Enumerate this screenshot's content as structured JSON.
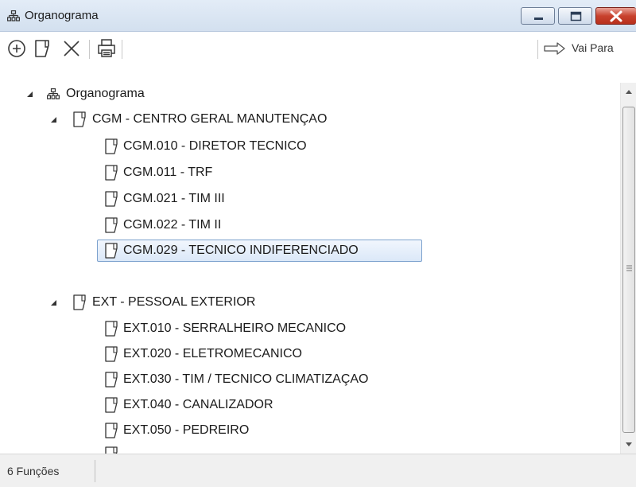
{
  "window": {
    "title": "Organograma",
    "title_icon": "org-chart-icon"
  },
  "title_buttons": {
    "minimize_icon": "minimize-icon",
    "maximize_icon": "maximize-icon",
    "close_icon": "close-icon"
  },
  "toolbar": {
    "add_icon": "add-circle-icon",
    "edit_icon": "edit-document-icon",
    "delete_icon": "delete-x-icon",
    "print_icon": "printer-icon",
    "goto_icon": "arrow-right-icon",
    "goto_label": "Vai Para"
  },
  "tree": {
    "root": {
      "label": "Organograma",
      "expanded": true,
      "icon": "org-chart-icon"
    },
    "groups": [
      {
        "label": "CGM - CENTRO GERAL MANUTENÇAO",
        "expanded": true,
        "icon": "document-icon",
        "children": [
          {
            "label": "CGM.010 - DIRETOR TECNICO",
            "selected": false
          },
          {
            "label": "CGM.011 - TRF",
            "selected": false
          },
          {
            "label": "CGM.021 - TIM III",
            "selected": false
          },
          {
            "label": "CGM.022 - TIM II",
            "selected": false
          },
          {
            "label": "CGM.029 - TECNICO INDIFERENCIADO",
            "selected": true
          }
        ]
      },
      {
        "label": "EXT - PESSOAL EXTERIOR",
        "expanded": true,
        "icon": "document-icon",
        "children": [
          {
            "label": "EXT.010 - SERRALHEIRO MECANICO",
            "selected": false
          },
          {
            "label": "EXT.020 - ELETROMECANICO",
            "selected": false
          },
          {
            "label": "EXT.030 - TIM / TECNICO CLIMATIZAÇAO",
            "selected": false
          },
          {
            "label": "EXT.040 - CANALIZADOR",
            "selected": false
          },
          {
            "label": "EXT.050 - PEDREIRO",
            "selected": false
          }
        ]
      }
    ]
  },
  "status": {
    "count_text": "6 Funções"
  },
  "colors": {
    "titlebar": "#d8e4f2",
    "close_button": "#c8422e",
    "selection_border": "#7da2ce",
    "selection_fill": "#e4eefa"
  }
}
